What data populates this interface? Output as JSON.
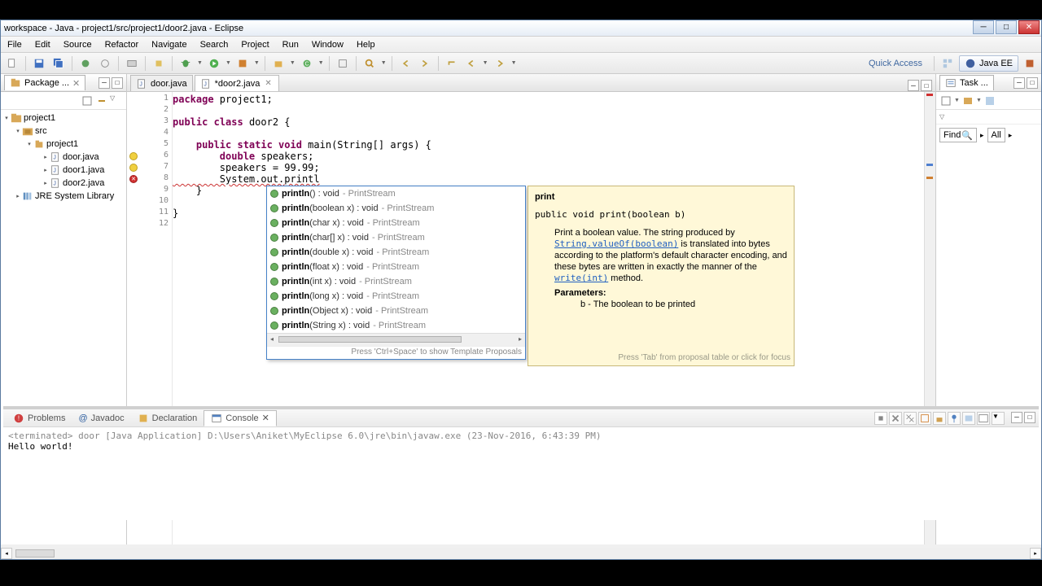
{
  "window": {
    "title": "workspace - Java - project1/src/project1/door2.java - Eclipse"
  },
  "menu": {
    "file": "File",
    "edit": "Edit",
    "source": "Source",
    "refactor": "Refactor",
    "navigate": "Navigate",
    "search": "Search",
    "project": "Project",
    "run": "Run",
    "window": "Window",
    "help": "Help"
  },
  "toolbar": {
    "quick_access": "Quick Access",
    "perspective": "Java EE"
  },
  "package_explorer": {
    "title": "Package ...",
    "project": "project1",
    "src_folder": "src",
    "package": "project1",
    "files": {
      "f0": "door.java",
      "f1": "door1.java",
      "f2": "door2.java"
    },
    "jre": "JRE System Library"
  },
  "editor": {
    "tab_inactive": "door.java",
    "tab_active": "*door2.java",
    "lines": {
      "n1": "1",
      "n2": "2",
      "n3": "3",
      "n4": "4",
      "n5": "5",
      "n6": "6",
      "n7": "7",
      "n8": "8",
      "n9": "9",
      "n10": "10",
      "n11": "11",
      "n12": "12"
    },
    "code": {
      "l1_pkg_kw": "package",
      "l1_rest": " project1;",
      "l3_pub": "public",
      "l3_class": "class",
      "l3_name": " door2 {",
      "l5_modifiers": "public static void",
      "l5_rest": " main(String[] args) {",
      "l6_kw": "double",
      "l6_rest": " speakers;",
      "l7": "        speakers = 99.99;",
      "l8": "        System.out.printl",
      "l9": "    }",
      "l11": "}"
    }
  },
  "autocomplete": {
    "hint": "Press 'Ctrl+Space' to show Template Proposals",
    "items": {
      "i0": {
        "sig": "println() : void",
        "src": " - PrintStream"
      },
      "i1": {
        "sig": "println(boolean x) : void",
        "src": " - PrintStream"
      },
      "i2": {
        "sig": "println(char x) : void",
        "src": " - PrintStream"
      },
      "i3": {
        "sig": "println(char[] x) : void",
        "src": " - PrintStream"
      },
      "i4": {
        "sig": "println(double x) : void",
        "src": " - PrintStream"
      },
      "i5": {
        "sig": "println(float x) : void",
        "src": " - PrintStream"
      },
      "i6": {
        "sig": "println(int x) : void",
        "src": " - PrintStream"
      },
      "i7": {
        "sig": "println(long x) : void",
        "src": " - PrintStream"
      },
      "i8": {
        "sig": "println(Object x) : void",
        "src": " - PrintStream"
      },
      "i9": {
        "sig": "println(String x) : void",
        "src": " - PrintStream"
      }
    }
  },
  "javadoc": {
    "title": "print",
    "signature": "public void print(boolean b)",
    "desc_1": "Print a boolean value. The string produced by ",
    "link1": "String.valueOf(boolean)",
    "desc_2": " is translated into bytes according to the platform's default character encoding, and these bytes are written in exactly the manner of the ",
    "link2": "write(int)",
    "desc_3": " method.",
    "params_label": "Parameters:",
    "param_b": "b - The boolean to be printed",
    "tab_hint": "Press 'Tab' from proposal table or click for focus"
  },
  "tasks": {
    "title": "Task ...",
    "find": "Find",
    "all": "All"
  },
  "bottom": {
    "problems": "Problems",
    "javadoc": "Javadoc",
    "declaration": "Declaration",
    "console": "Console",
    "con_header": "<terminated> door [Java Application] D:\\Users\\Aniket\\MyEclipse 6.0\\jre\\bin\\javaw.exe (23-Nov-2016, 6:43:39 PM)",
    "con_output": "Hello world!"
  }
}
